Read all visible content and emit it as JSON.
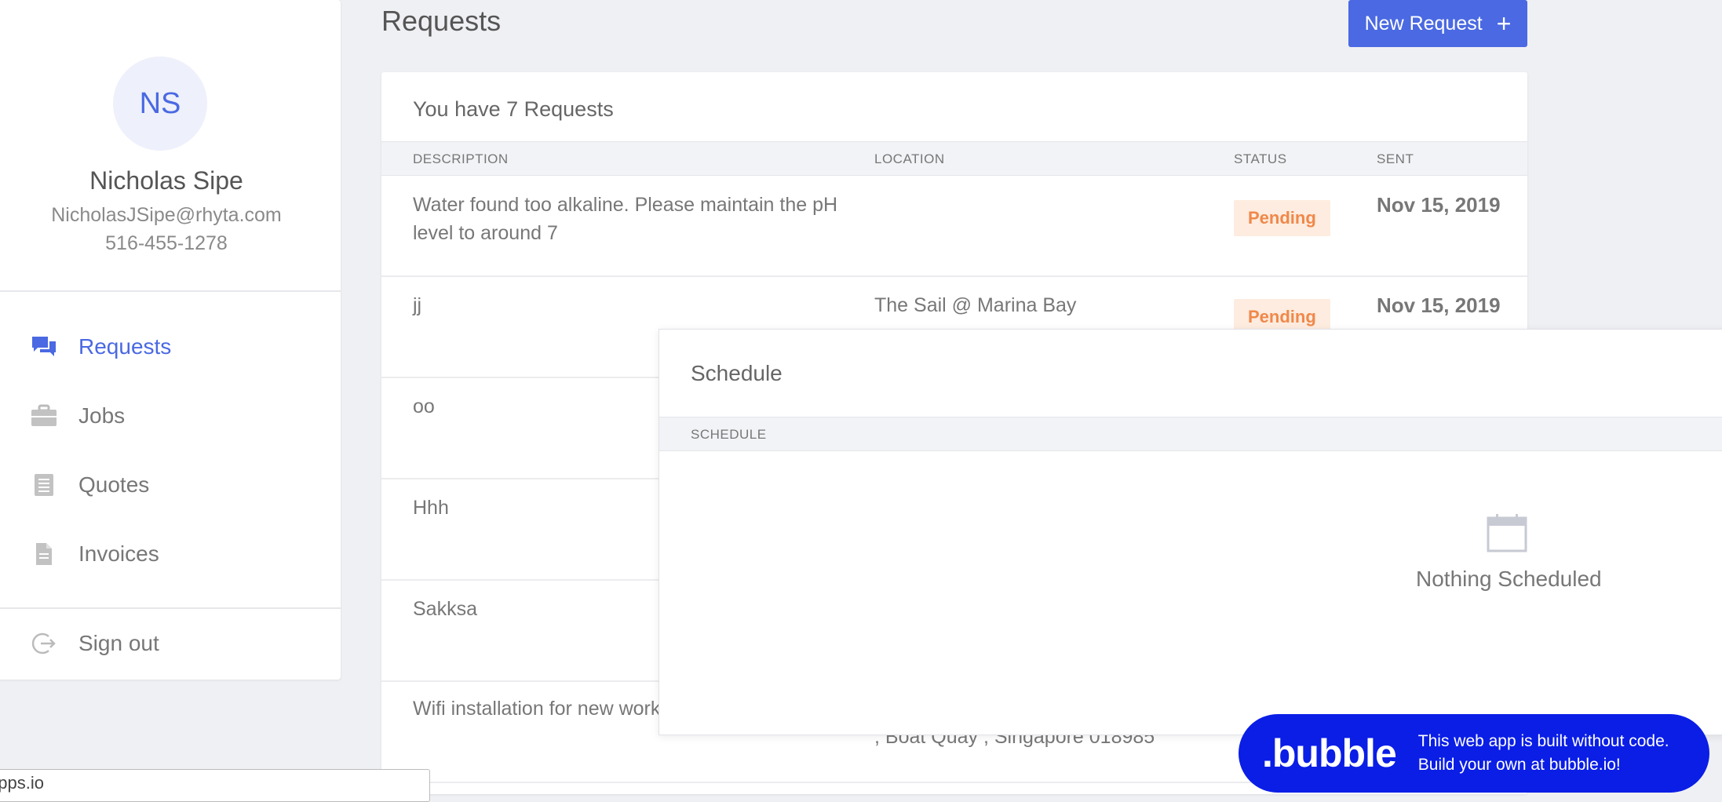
{
  "profile": {
    "initials": "NS",
    "name": "Nicholas Sipe",
    "email": "NicholasJSipe@rhyta.com",
    "phone": "516-455-1278"
  },
  "nav": {
    "requests": "Requests",
    "jobs": "Jobs",
    "quotes": "Quotes",
    "invoices": "Invoices",
    "sign_out": "Sign out"
  },
  "header": {
    "title": "Requests",
    "new_request": "New Request"
  },
  "requests": {
    "summary": "You have 7 Requests",
    "columns": {
      "description": "DESCRIPTION",
      "location": "LOCATION",
      "status": "STATUS",
      "sent": "SENT"
    },
    "rows": [
      {
        "description": "Water found too alkaline. Please maintain the pH level to around 7",
        "location": "",
        "status": "Pending",
        "sent": "Nov 15, 2019"
      },
      {
        "description": "jj",
        "location": "The Sail @ Marina Bay",
        "status": "Pending",
        "sent": "Nov 15, 2019"
      },
      {
        "description": "oo",
        "location": "",
        "status": "",
        "sent": ""
      },
      {
        "description": "Hhh",
        "location": "",
        "status": "",
        "sent": ""
      },
      {
        "description": "Sakksa",
        "location": "",
        "status": "",
        "sent": ""
      },
      {
        "description": "Wifi installation for new work",
        "location": ", Boat Quay , Singapore 018985",
        "status": "",
        "sent": ""
      }
    ]
  },
  "schedule": {
    "title": "Schedule",
    "column": "SCHEDULE",
    "empty_text": "Nothing Scheduled"
  },
  "bubble": {
    "logo": ".bubble",
    "line1": "This web app is built without code.",
    "line2": "Build your own at bubble.io!"
  },
  "url_tooltip": "apps.io",
  "colors": {
    "accent": "#4a69e2",
    "pending_bg": "#fdecdf",
    "pending_text": "#f0884a",
    "bubble_blue": "#0a1ee6"
  }
}
